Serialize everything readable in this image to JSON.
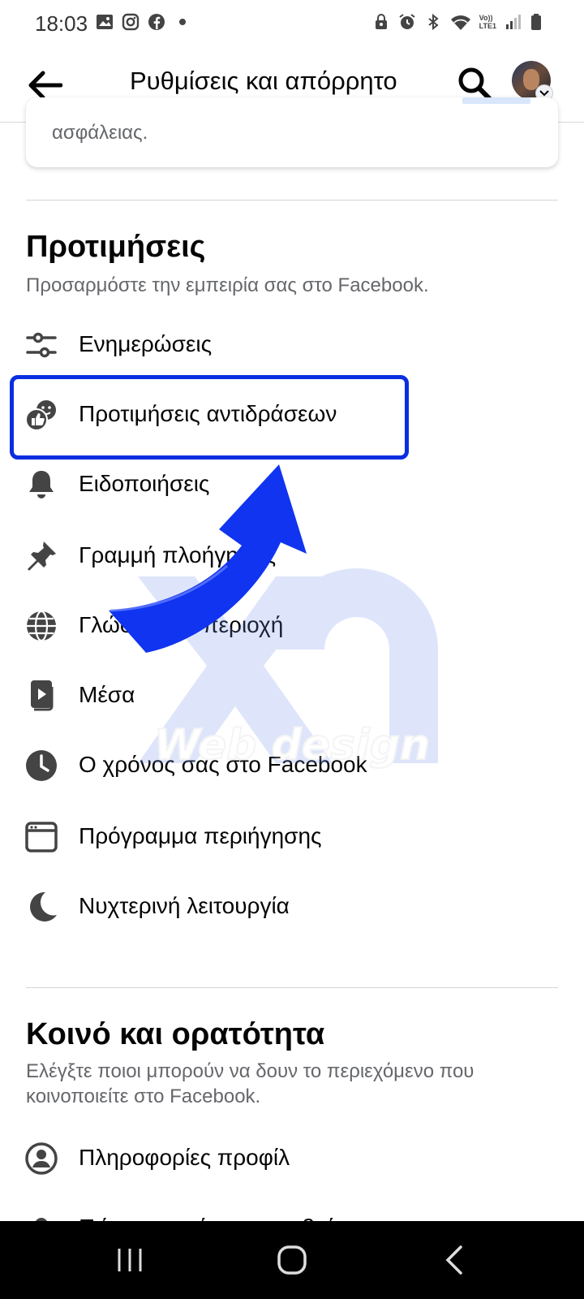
{
  "status_bar": {
    "time": "18:03",
    "left_icons": [
      "gallery-icon",
      "instagram-icon",
      "facebook-icon",
      "dot-icon"
    ],
    "right_icons": [
      "lock-icon",
      "alarm-icon",
      "bluetooth-icon",
      "wifi-icon",
      "volte-icon",
      "signal-icon",
      "battery-icon"
    ],
    "volte_label_top": "Vo))",
    "volte_label_bottom": "LTE1"
  },
  "header": {
    "title": "Ρυθμίσεις και απόρρητο",
    "back_icon": "arrow-left-icon",
    "search_icon": "search-icon"
  },
  "card": {
    "text": "ασφάλειας."
  },
  "preferences": {
    "title": "Προτιμήσεις",
    "subtitle": "Προσαρμόστε την εμπειρία σας στο Facebook.",
    "items": [
      {
        "label": "Ενημερώσεις",
        "icon": "sliders-icon"
      },
      {
        "label": "Προτιμήσεις αντιδράσεων",
        "icon": "reactions-icon"
      },
      {
        "label": "Ειδοποιήσεις",
        "icon": "bell-icon"
      },
      {
        "label": "Γραμμή πλοήγησης",
        "icon": "pin-icon"
      },
      {
        "label": "Γλώσσα και περιοχή",
        "icon": "globe-icon"
      },
      {
        "label": "Μέσα",
        "icon": "media-icon"
      },
      {
        "label": "Ο χρόνος σας στο Facebook",
        "icon": "clock-icon"
      },
      {
        "label": "Πρόγραμμα περιήγησης",
        "icon": "browser-icon"
      },
      {
        "label": "Νυχτερινή λειτουργία",
        "icon": "moon-icon"
      }
    ]
  },
  "audience": {
    "title": "Κοινό και ορατότητα",
    "subtitle": "Ελέγξτε ποιοι μπορούν να δουν το περιεχόμενο που κοινοποιείτε στο Facebook.",
    "items": [
      {
        "label": "Πληροφορίες προφίλ",
        "icon": "profile-icon"
      },
      {
        "label": "Πώς μπορούν να σας βρίσκουν και να",
        "icon": "people-icon"
      }
    ]
  },
  "watermark": {
    "text": "Web design"
  },
  "colors": {
    "highlight": "#0a2ee0",
    "arrow": "#1034f0",
    "secondary_text": "#65676b"
  },
  "nav_bar": {
    "buttons": [
      "recents-icon",
      "home-icon",
      "back-icon"
    ]
  }
}
